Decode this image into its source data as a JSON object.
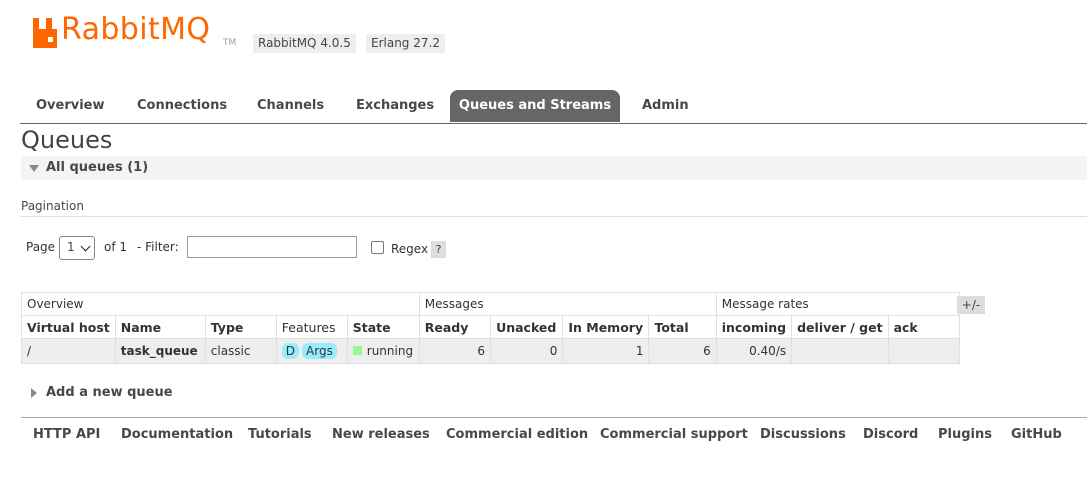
{
  "header": {
    "brand": "RabbitMQ",
    "tm": "TM",
    "version_badge": "RabbitMQ 4.0.5",
    "erlang_badge": "Erlang 27.2"
  },
  "tabs": [
    {
      "label": "Overview"
    },
    {
      "label": "Connections"
    },
    {
      "label": "Channels"
    },
    {
      "label": "Exchanges"
    },
    {
      "label": "Queues and Streams",
      "active": true
    },
    {
      "label": "Admin"
    }
  ],
  "page_title": "Queues",
  "section_title": "All queues (1)",
  "pagination": {
    "label": "Pagination",
    "page_label": "Page",
    "page_value": "1",
    "of_label": "of 1",
    "filter_label": "- Filter:",
    "filter_value": "",
    "regex_label": "Regex",
    "regex_checked": false,
    "help": "?"
  },
  "table": {
    "groups": [
      "Overview",
      "Messages",
      "Message rates"
    ],
    "plus_minus": "+/-",
    "columns": [
      "Virtual host",
      "Name",
      "Type",
      "Features",
      "State",
      "Ready",
      "Unacked",
      "In Memory",
      "Total",
      "incoming",
      "deliver / get",
      "ack"
    ],
    "rows": [
      {
        "vhost": "/",
        "name": "task_queue",
        "type": "classic",
        "features": [
          "D",
          "Args"
        ],
        "state": "running",
        "ready": "6",
        "unacked": "0",
        "in_memory": "1",
        "total": "6",
        "incoming": "0.40/s",
        "deliver_get": "",
        "ack": ""
      }
    ]
  },
  "add_queue": "Add a new queue",
  "footer": [
    "HTTP API",
    "Documentation",
    "Tutorials",
    "New releases",
    "Commercial edition",
    "Commercial support",
    "Discussions",
    "Discord",
    "Plugins",
    "GitHub"
  ],
  "colors": {
    "brand": "#ff6600",
    "active_tab": "#666666",
    "feature_pill": "#99ebff",
    "running": "#98f898"
  }
}
